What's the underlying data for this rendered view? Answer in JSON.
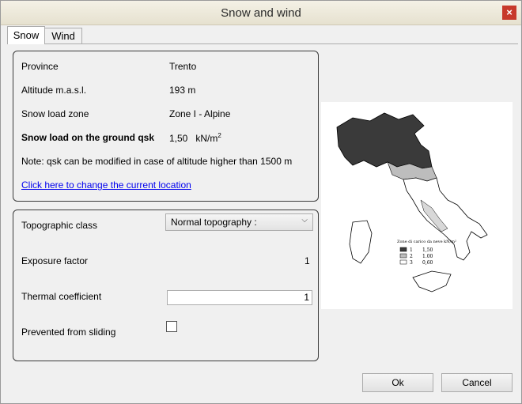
{
  "window": {
    "title": "Snow and wind",
    "close_symbol": "×"
  },
  "tabs": [
    {
      "label": "Snow",
      "active": true
    },
    {
      "label": "Wind",
      "active": false
    }
  ],
  "location": {
    "province_label": "Province",
    "province_value": "Trento",
    "altitude_label": "Altitude m.a.s.l.",
    "altitude_value": "193 m",
    "zone_label": "Snow load zone",
    "zone_value": "Zone I - Alpine",
    "snowload_label": "Snow load on the ground qsk",
    "snowload_value": "1,50",
    "snowload_unit": "kN/m",
    "snowload_unit_exp": "2",
    "note": "Note: qsk can be modified in case of altitude higher than 1500 m",
    "change_link": "Click here to change the current location"
  },
  "coefficients": {
    "topo_label": "Topographic class",
    "topo_value": "Normal topography :",
    "exposure_label": "Exposure factor",
    "exposure_value": "1",
    "thermal_label": "Thermal coefficient",
    "thermal_value": "1",
    "sliding_label": "Prevented from sliding",
    "sliding_checked": false
  },
  "map": {
    "legend_title": "Zone di carico da neve kN/m²",
    "legend": [
      {
        "zone": "1",
        "value": "1,50"
      },
      {
        "zone": "2",
        "value": "1.00"
      },
      {
        "zone": "3",
        "value": "0,60"
      }
    ]
  },
  "buttons": {
    "ok": "Ok",
    "cancel": "Cancel"
  },
  "colors": {
    "titlebar": "#ece9d8",
    "link": "#0000ee",
    "close": "#c7392b"
  }
}
